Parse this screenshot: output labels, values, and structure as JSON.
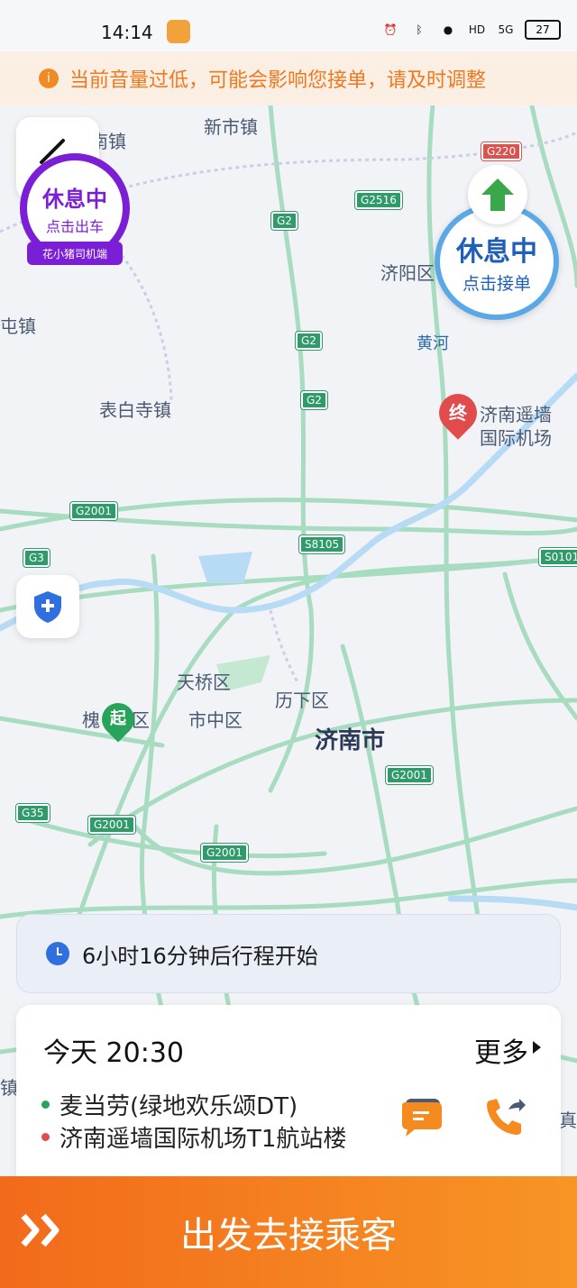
{
  "status_bar": {
    "time": "14:14",
    "battery": "27",
    "network": "5G",
    "hd": "HD"
  },
  "notice": {
    "icon": "info-icon",
    "text": "当前音量过低，可能会影响您接单，请及时调整"
  },
  "map": {
    "places": {
      "xinshi": "新市镇",
      "nanzhen": "南镇",
      "jiyang": "济阳区",
      "tunzhen": "屯镇",
      "huanghe": "黄河",
      "biaobaisi": "表白寺镇",
      "tianqiao": "天桥区",
      "lixia": "历下区",
      "huai": "槐",
      "qu": "区",
      "shizhong": "市中区",
      "jinan": "济南市",
      "airport_line1": "济南遥墙",
      "airport_line2": "国际机场",
      "zhen_edge": "镇",
      "zhen_edge2": "镇",
      "zhen_edge3": "真"
    },
    "highways": {
      "g220": "G220",
      "g2516": "G2516",
      "g2_a": "G2",
      "g2_b": "G2",
      "g2_c": "G2",
      "g2001_a": "G2001",
      "g3": "G3",
      "s8105": "S8105",
      "s0101": "S0101",
      "g2001_b": "G2001",
      "g35": "G35",
      "g2001_c": "G2001",
      "g2001_d": "G2001"
    },
    "markers": {
      "start": "起",
      "end": "终"
    }
  },
  "rest_left": {
    "title": "休息中",
    "subtitle": "点击出车",
    "tag": "花小猪司机端"
  },
  "rest_right": {
    "title": "休息中",
    "subtitle": "点击接单"
  },
  "info": {
    "text": "6小时16分钟后行程开始"
  },
  "order": {
    "time": "今天 20:30",
    "more": "更多",
    "pickup": "麦当劳(绿地欢乐颂DT)",
    "dropoff": "济南遥墙国际机场T1航站楼"
  },
  "go_button": {
    "label": "出发去接乘客"
  },
  "colors": {
    "accent": "#f26a1b",
    "purple": "#7a1fd6",
    "blue": "#1e5fb8",
    "green": "#27a35a",
    "red": "#e14b4b"
  }
}
